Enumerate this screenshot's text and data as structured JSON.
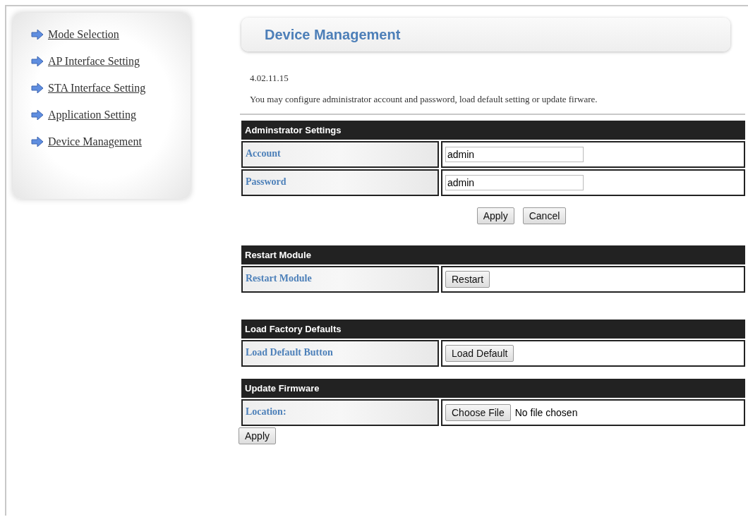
{
  "sidebar": {
    "items": [
      {
        "label": "Mode Selection"
      },
      {
        "label": "AP Interface Setting"
      },
      {
        "label": "STA Interface Setting"
      },
      {
        "label": "Application Setting"
      },
      {
        "label": "Device Management"
      }
    ]
  },
  "page": {
    "title": "Device Management",
    "version": "4.02.11.15",
    "description": "You may configure administrator account and password, load default setting or update firware."
  },
  "sections": [
    {
      "title": "Adminstrator Settings",
      "rows": [
        {
          "kind": "input",
          "label": "Account",
          "value": "admin"
        },
        {
          "kind": "input",
          "label": "Password",
          "value": "admin"
        }
      ],
      "buttons": [
        "Apply",
        "Cancel"
      ],
      "kind": "form"
    },
    {
      "title": "Restart Module",
      "rows": [
        {
          "kind": "button",
          "label": "Restart Module",
          "button": "Restart"
        }
      ]
    },
    {
      "title": "Load Factory Defaults",
      "rows": [
        {
          "kind": "button",
          "label": "Load Default Button",
          "button": "Load Default"
        }
      ]
    },
    {
      "title": "Update Firmware",
      "rows": [
        {
          "kind": "file",
          "label": "Location:",
          "button": "Choose File",
          "status": "No file chosen"
        }
      ],
      "buttons": [
        "Apply"
      ],
      "kind": "upload"
    }
  ]
}
